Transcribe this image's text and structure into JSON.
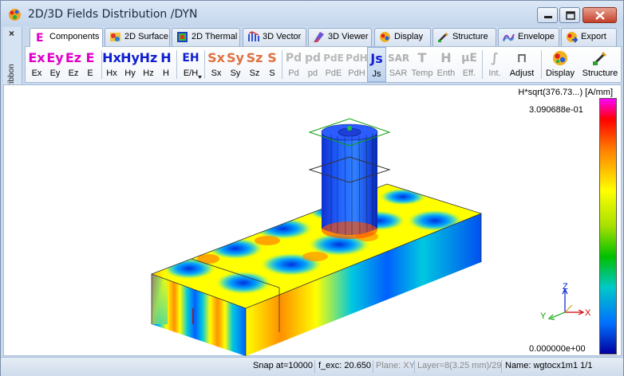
{
  "window": {
    "title": "2D/3D Fields Distribution /DYN",
    "controls": {
      "minimize": "minimize-icon",
      "maximize": "maximize-icon",
      "close": "close-icon"
    }
  },
  "ribbon": {
    "side_close": "×",
    "side_label": "Ribbon",
    "tabs": [
      {
        "label": "Components",
        "icon": "e-field-icon",
        "active": true
      },
      {
        "label": "2D Surface",
        "icon": "surface-icon"
      },
      {
        "label": "2D Thermal",
        "icon": "thermal-icon"
      },
      {
        "label": "3D Vector",
        "icon": "vector-icon"
      },
      {
        "label": "3D Viewer",
        "icon": "viewer-icon"
      },
      {
        "label": "Display",
        "icon": "display-icon"
      },
      {
        "label": "Structure",
        "icon": "structure-icon"
      },
      {
        "label": "Envelope",
        "icon": "envelope-icon"
      },
      {
        "label": "Export",
        "icon": "export-icon"
      }
    ],
    "buttons": [
      {
        "glyph": "Ex",
        "label": "Ex",
        "color": "#e000c8"
      },
      {
        "glyph": "Ey",
        "label": "Ey",
        "color": "#e000c8"
      },
      {
        "glyph": "Ez",
        "label": "Ez",
        "color": "#e000c8"
      },
      {
        "glyph": "E",
        "label": "E",
        "color": "#e000c8"
      },
      {
        "glyph": "Hx",
        "label": "Hx",
        "color": "#1020d0"
      },
      {
        "glyph": "Hy",
        "label": "Hy",
        "color": "#1020d0"
      },
      {
        "glyph": "Hz",
        "label": "Hz",
        "color": "#1020d0"
      },
      {
        "glyph": "H",
        "label": "H",
        "color": "#1020d0"
      },
      {
        "glyph": "EH",
        "label": "E/H",
        "color": "#1020d0"
      },
      {
        "glyph": "Sx",
        "label": "Sx",
        "color": "#e07040"
      },
      {
        "glyph": "Sy",
        "label": "Sy",
        "color": "#e07040"
      },
      {
        "glyph": "Sz",
        "label": "Sz",
        "color": "#e07040"
      },
      {
        "glyph": "S",
        "label": "S",
        "color": "#e07040"
      },
      {
        "glyph": "Pd",
        "label": "Pd",
        "color": "#b8b8b8"
      },
      {
        "glyph": "pd",
        "label": "pd",
        "color": "#b8b8b8"
      },
      {
        "glyph": "PdE",
        "label": "PdE",
        "color": "#b8b8b8"
      },
      {
        "glyph": "PdH",
        "label": "PdH",
        "color": "#b8b8b8"
      },
      {
        "glyph": "Js",
        "label": "Js",
        "color": "#1020d0"
      },
      {
        "glyph": "SAR",
        "label": "SAR",
        "color": "#b0b0b0"
      },
      {
        "glyph": "T",
        "label": "Temp",
        "color": "#b0b0b0"
      },
      {
        "glyph": "H",
        "label": "Enth",
        "color": "#b0b0b0"
      },
      {
        "glyph": "μE",
        "label": "Eff.",
        "color": "#b0b0b0"
      },
      {
        "glyph": "∫",
        "label": "Int.",
        "color": "#b0b0b0"
      },
      {
        "glyph": "⊓",
        "label": "Adjust",
        "color": "#606060"
      },
      {
        "glyph": "▣",
        "label": "Display",
        "color": "#d03030"
      },
      {
        "glyph": "✎",
        "label": "Structure",
        "color": "#30a030"
      }
    ]
  },
  "view": {
    "scale_title": "H*sqrt(376.73...) [A/mm]",
    "scale_max": "3.090688e-01",
    "scale_min": "0.000000e+00",
    "axes": {
      "x": "X",
      "y": "Y",
      "z": "Z"
    }
  },
  "status": {
    "snap": "Snap at=10000",
    "f_exc": "f_exc: 20.650",
    "plane": "Plane: XY",
    "layer": "Layer=8(3.25 mm)/29",
    "name": "Name: wgtocx1m1 1/1"
  }
}
